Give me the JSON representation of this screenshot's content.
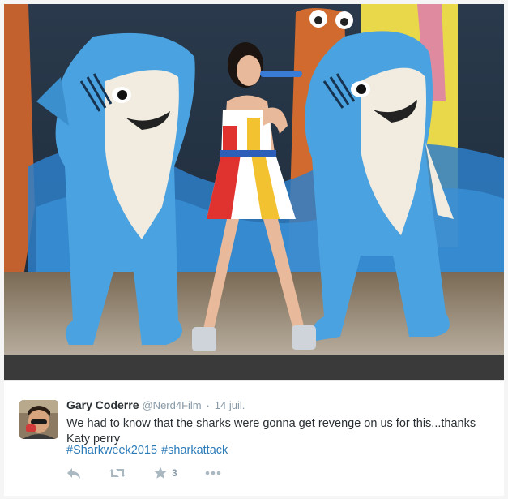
{
  "tweet": {
    "user_name": "Gary Coderre",
    "user_handle": "@Nerd4Film",
    "separator": "·",
    "timestamp": "14 juil.",
    "text": "We had to know that the sharks were gonna get revenge on us for this...thanks Katy perry",
    "hashtags": [
      "#Sharkweek2015",
      "#sharkattack"
    ],
    "favorite_count": "3"
  },
  "icons": {
    "reply": "reply-icon",
    "retweet": "retweet-icon",
    "favorite": "star-icon",
    "more": "more-icon"
  },
  "colors": {
    "link": "#2b7bb9",
    "text": "#292f33",
    "muted": "#8899a6",
    "icon": "#aab8c2",
    "shark_blue": "#4aa3e0"
  }
}
